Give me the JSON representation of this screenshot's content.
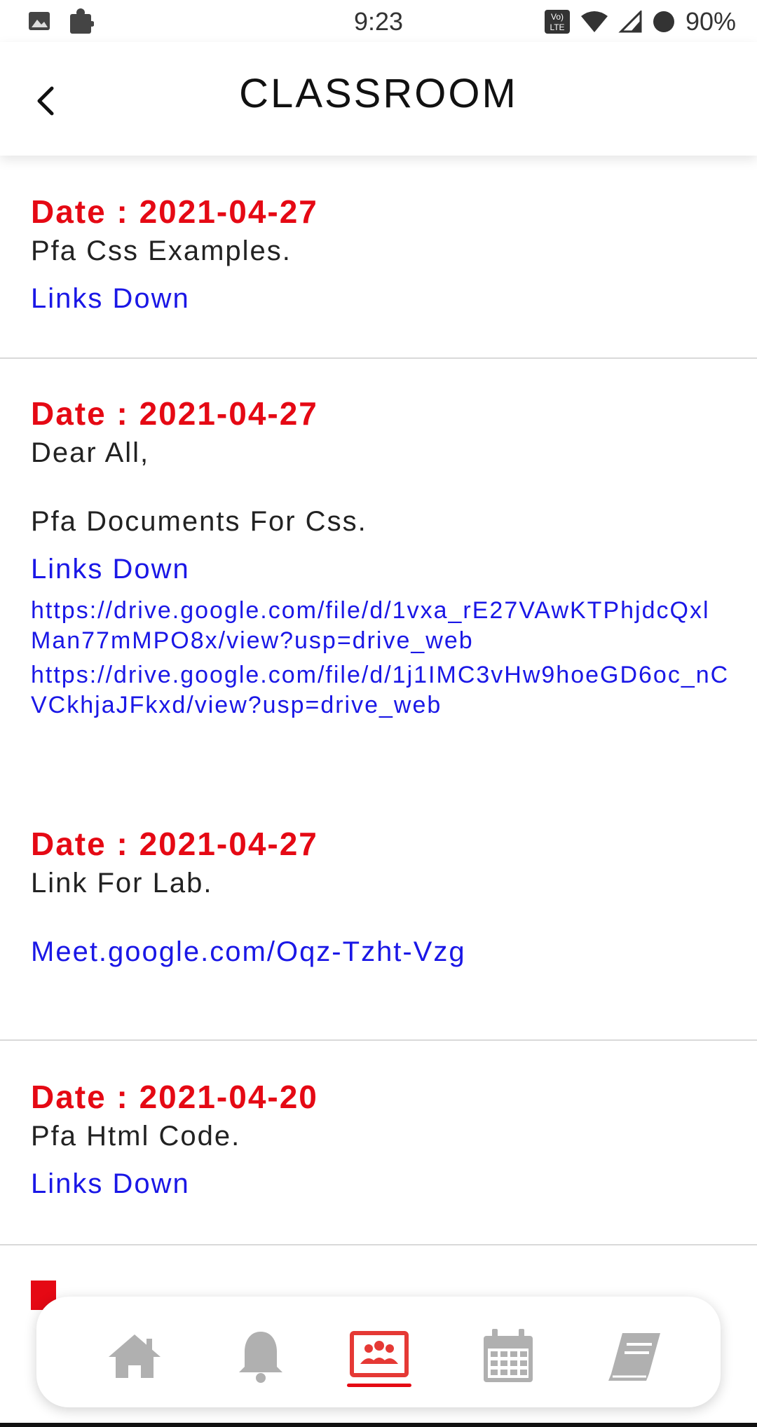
{
  "status_bar": {
    "time": "9:23",
    "battery": "90%",
    "left_icons": [
      "image-icon",
      "puzzle-icon"
    ],
    "right_icons": [
      "volte-icon",
      "wifi-icon",
      "signal-icon",
      "battery-icon"
    ]
  },
  "header": {
    "title": "CLASSROOM",
    "back_icon": "chevron-left-icon"
  },
  "entries": [
    {
      "date": "Date : 2021-04-27",
      "text": "Pfa Css Examples.",
      "link": "Links Down"
    },
    {
      "date": "Date : 2021-04-27",
      "greeting": "Dear All,",
      "text": "Pfa Documents For Css.",
      "link": "Links Down",
      "url1": "https://drive.google.com/file/d/1vxa_rE27VAwKTPhjdcQxlMan77mMPO8x/view?usp=drive_web",
      "url2": "https://drive.google.com/file/d/1j1IMC3vHw9hoeGD6oc_nCVCkhjaJFkxd/view?usp=drive_web"
    },
    {
      "date": "Date : 2021-04-27",
      "text": "Link For Lab.",
      "link": "Meet.google.com/Oqz-Tzht-Vzg"
    },
    {
      "date": "Date : 2021-04-20",
      "text": "Pfa Html Code.",
      "link": "Links Down"
    }
  ],
  "bottom_nav": {
    "items": [
      "home-icon",
      "bell-icon",
      "classroom-icon",
      "calendar-icon",
      "book-icon"
    ],
    "active": "classroom-icon"
  },
  "colors": {
    "date_red": "#e50914",
    "link_blue": "#1a17e6",
    "inactive_icon": "#b0b0b0"
  }
}
